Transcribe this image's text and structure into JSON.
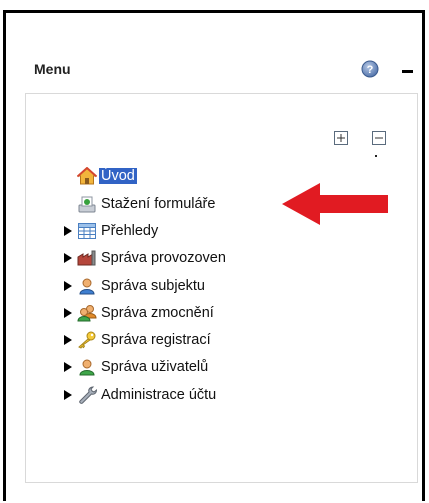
{
  "panel": {
    "title": "Menu"
  },
  "icons": {
    "help": "help-icon",
    "expand_all": "expand-all-icon",
    "collapse_all": "collapse-all-icon"
  },
  "tree": {
    "items": [
      {
        "label": "Úvod",
        "icon": "home-icon",
        "selected": true,
        "has_children": false
      },
      {
        "label": "Stažení formuláře",
        "icon": "download-form-icon",
        "selected": false,
        "has_children": false
      },
      {
        "label": "Přehledy",
        "icon": "table-icon",
        "selected": false,
        "has_children": true
      },
      {
        "label": "Správa provozoven",
        "icon": "factory-icon",
        "selected": false,
        "has_children": true
      },
      {
        "label": "Správa subjektu",
        "icon": "user-icon",
        "selected": false,
        "has_children": true
      },
      {
        "label": "Správa zmocnění",
        "icon": "users-icon",
        "selected": false,
        "has_children": true
      },
      {
        "label": "Správa registrací",
        "icon": "key-icon",
        "selected": false,
        "has_children": true
      },
      {
        "label": "Správa uživatelů",
        "icon": "user-green-icon",
        "selected": false,
        "has_children": true
      },
      {
        "label": "Administrace účtu",
        "icon": "wrench-icon",
        "selected": false,
        "has_children": true
      }
    ]
  },
  "colors": {
    "selection": "#3163c5",
    "annotation_arrow": "#e11b22"
  }
}
